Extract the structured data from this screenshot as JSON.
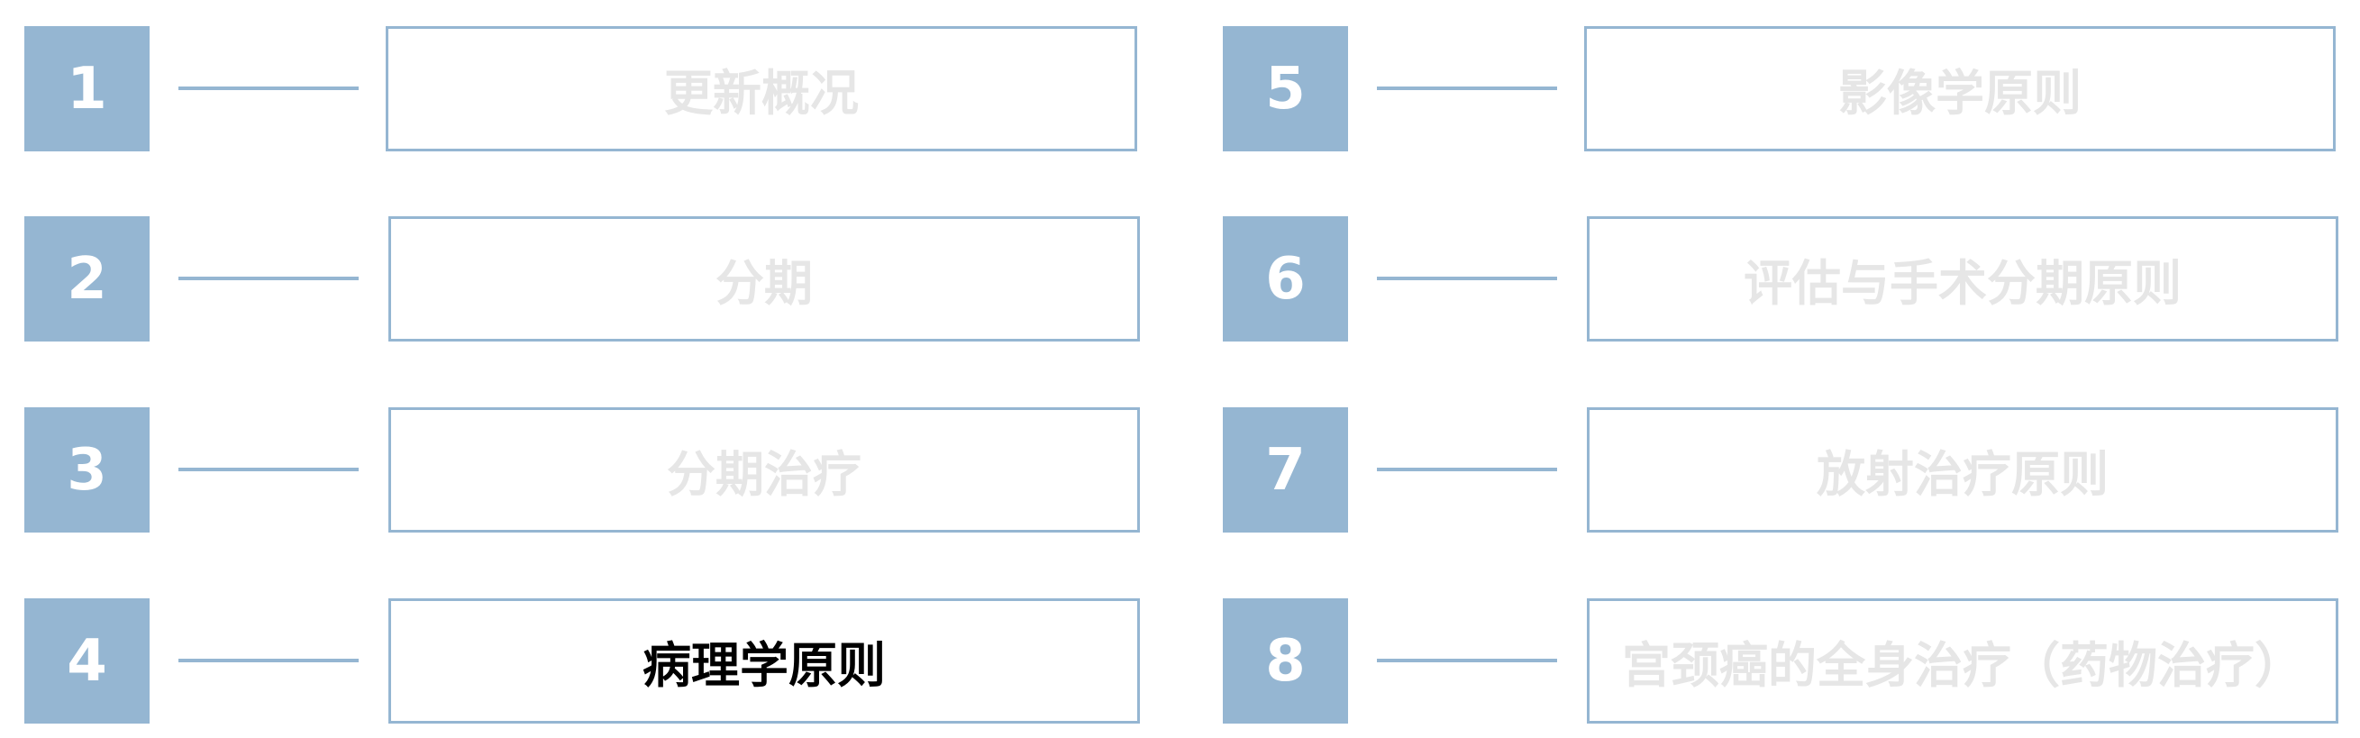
{
  "colors": {
    "accent": "#95b6d2",
    "inactive_text": "#e6e6e6",
    "active_text": "#000000",
    "badge_text": "#ffffff"
  },
  "sections": [
    {
      "number": "1",
      "title": "更新概况",
      "active": false
    },
    {
      "number": "2",
      "title": "分期",
      "active": false
    },
    {
      "number": "3",
      "title": "分期治疗",
      "active": false
    },
    {
      "number": "4",
      "title": "病理学原则",
      "active": true
    },
    {
      "number": "5",
      "title": "影像学原则",
      "active": false
    },
    {
      "number": "6",
      "title": "评估与手术分期原则",
      "active": false
    },
    {
      "number": "7",
      "title": "放射治疗原则",
      "active": false
    },
    {
      "number": "8",
      "title": "宫颈癌的全身治疗（药物治疗）",
      "active": false
    }
  ]
}
